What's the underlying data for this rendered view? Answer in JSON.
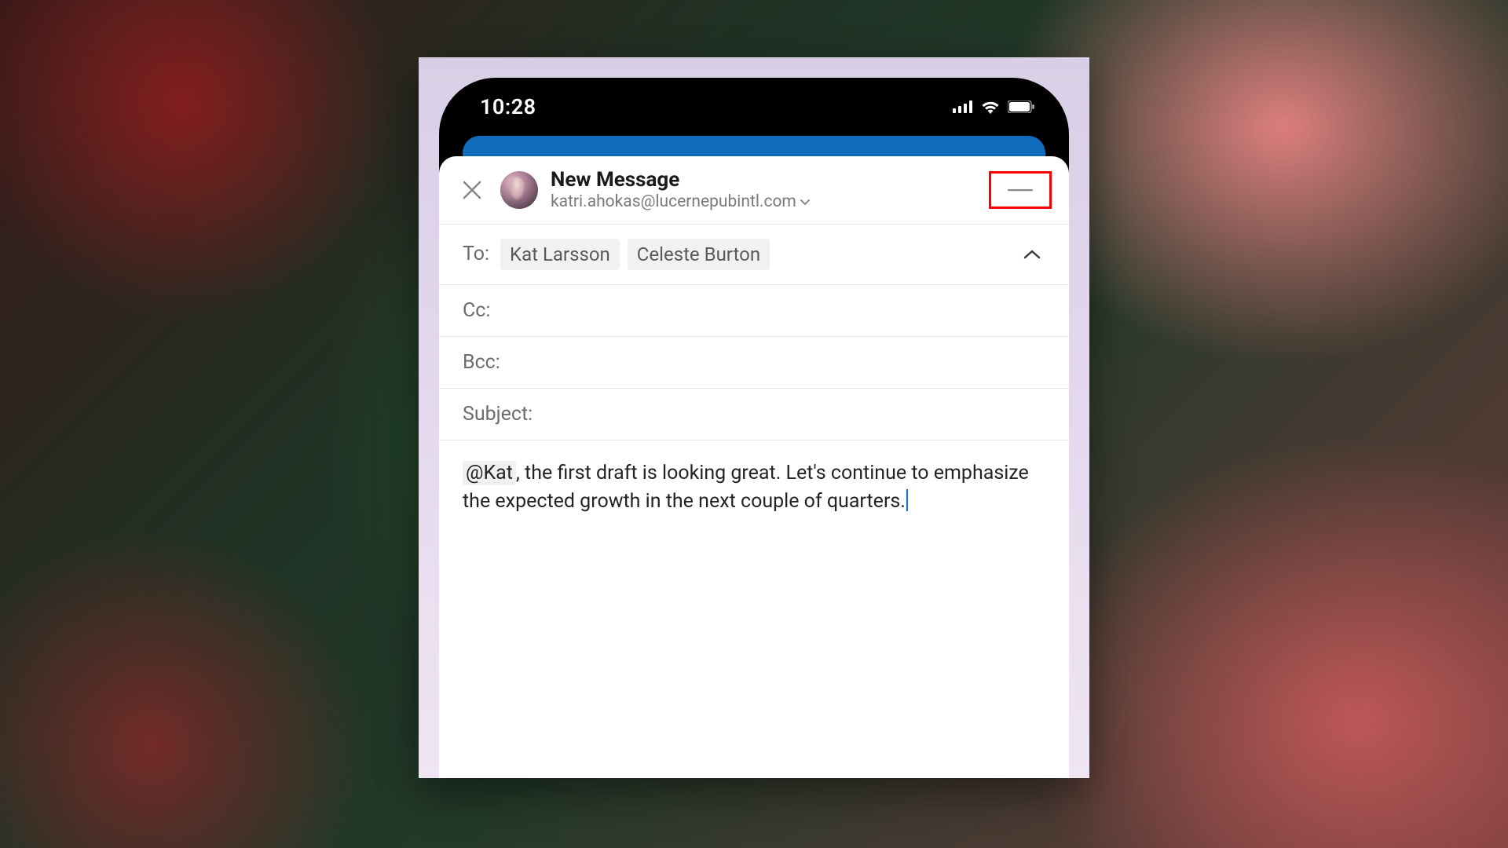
{
  "status": {
    "time": "10:28"
  },
  "header": {
    "title": "New Message",
    "from_email": "katri.ahokas@lucernepubintl.com"
  },
  "fields": {
    "to_label": "To:",
    "to_recipients": [
      "Kat Larsson",
      "Celeste Burton"
    ],
    "cc_label": "Cc:",
    "bcc_label": "Bcc:",
    "subject_label": "Subject:"
  },
  "body": {
    "mention": "@Kat",
    "rest": ", the first draft is looking great. Let's continue to emphasize the expected growth in the next couple of quarters."
  }
}
